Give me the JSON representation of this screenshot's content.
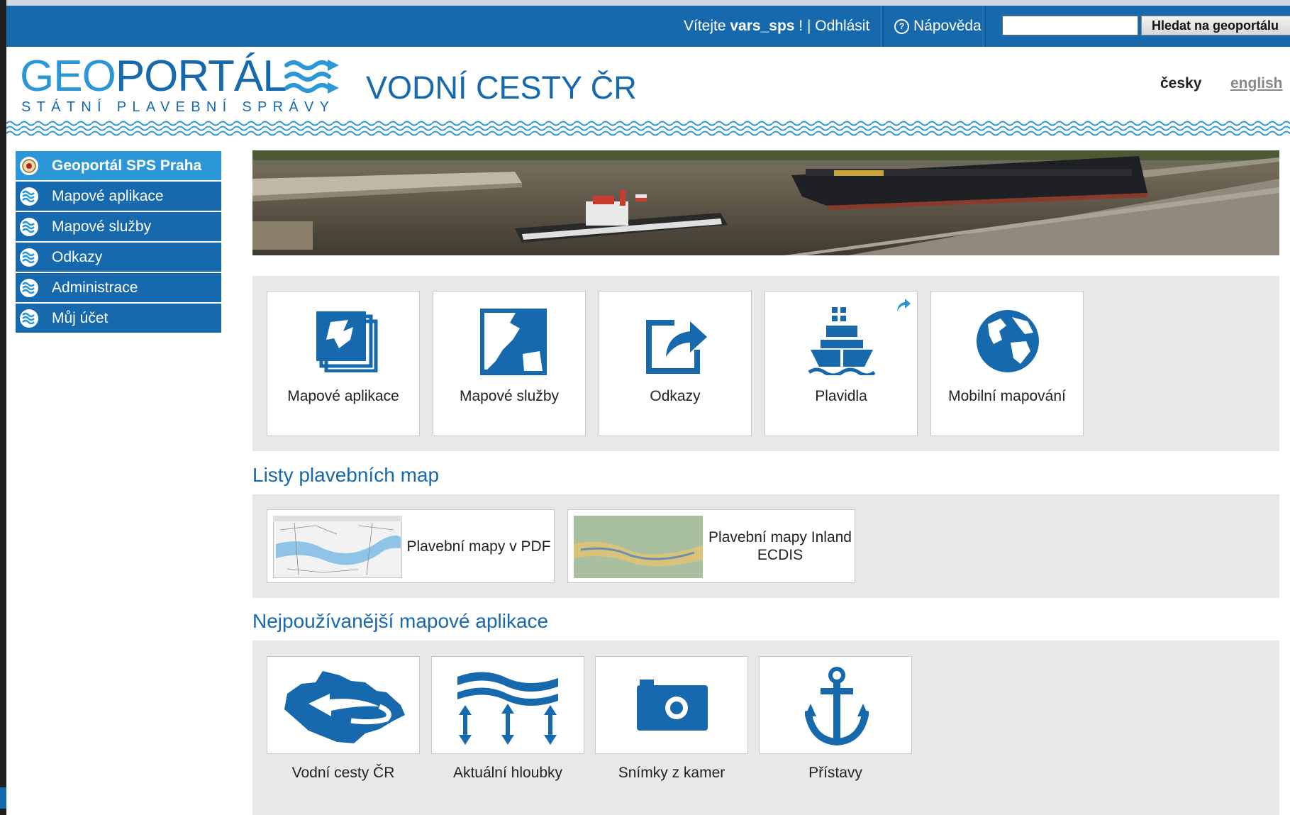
{
  "topbar": {
    "welcome_prefix": "Vítejte ",
    "username": "vars_sps",
    "welcome_suffix": " ! | ",
    "logout": "Odhlásit",
    "help": "Nápověda",
    "search_value": "",
    "search_button": "Hledat na geoportálu"
  },
  "header": {
    "logo_geo": "GEO",
    "logo_portal": "PORTÁL",
    "logo_subtitle": "STÁTNÍ PLAVEBNÍ SPRÁVY",
    "title": "VODNÍ CESTY ČR",
    "lang_cz": "česky",
    "lang_en": "english"
  },
  "sidebar": {
    "items": [
      {
        "label": "Geoportál SPS Praha",
        "icon": "emblem-icon"
      },
      {
        "label": "Mapové aplikace",
        "icon": "waves-icon"
      },
      {
        "label": "Mapové služby",
        "icon": "waves-icon"
      },
      {
        "label": "Odkazy",
        "icon": "waves-icon"
      },
      {
        "label": "Administrace",
        "icon": "waves-icon"
      },
      {
        "label": "Můj účet",
        "icon": "waves-icon"
      }
    ]
  },
  "main": {
    "top_tiles": [
      {
        "label": "Mapové aplikace",
        "icon": "map-stack-icon"
      },
      {
        "label": "Mapové služby",
        "icon": "map-icon"
      },
      {
        "label": "Odkazy",
        "icon": "external-link-icon"
      },
      {
        "label": "Plavidla",
        "icon": "ship-icon"
      },
      {
        "label": "Mobilní mapování",
        "icon": "globe-icon"
      }
    ],
    "maps_section": {
      "title": "Listy plavebních map",
      "items": [
        {
          "label": "Plavební mapy v PDF"
        },
        {
          "label_line1": "Plavební mapy Inland",
          "label_line2": "ECDIS"
        }
      ]
    },
    "apps_section": {
      "title": "Nejpoužívanější mapové aplikace",
      "items": [
        {
          "label": "Vodní cesty ČR",
          "icon": "czech-map-icon"
        },
        {
          "label": "Aktuální hloubky",
          "icon": "depth-icon"
        },
        {
          "label": "Snímky z kamer",
          "icon": "camera-icon"
        },
        {
          "label": "Přístavy",
          "icon": "anchor-icon"
        }
      ]
    }
  },
  "colors": {
    "brand_blue": "#1769ad",
    "light_blue": "#2b97d6",
    "panel_gray": "#e8e8e8"
  }
}
